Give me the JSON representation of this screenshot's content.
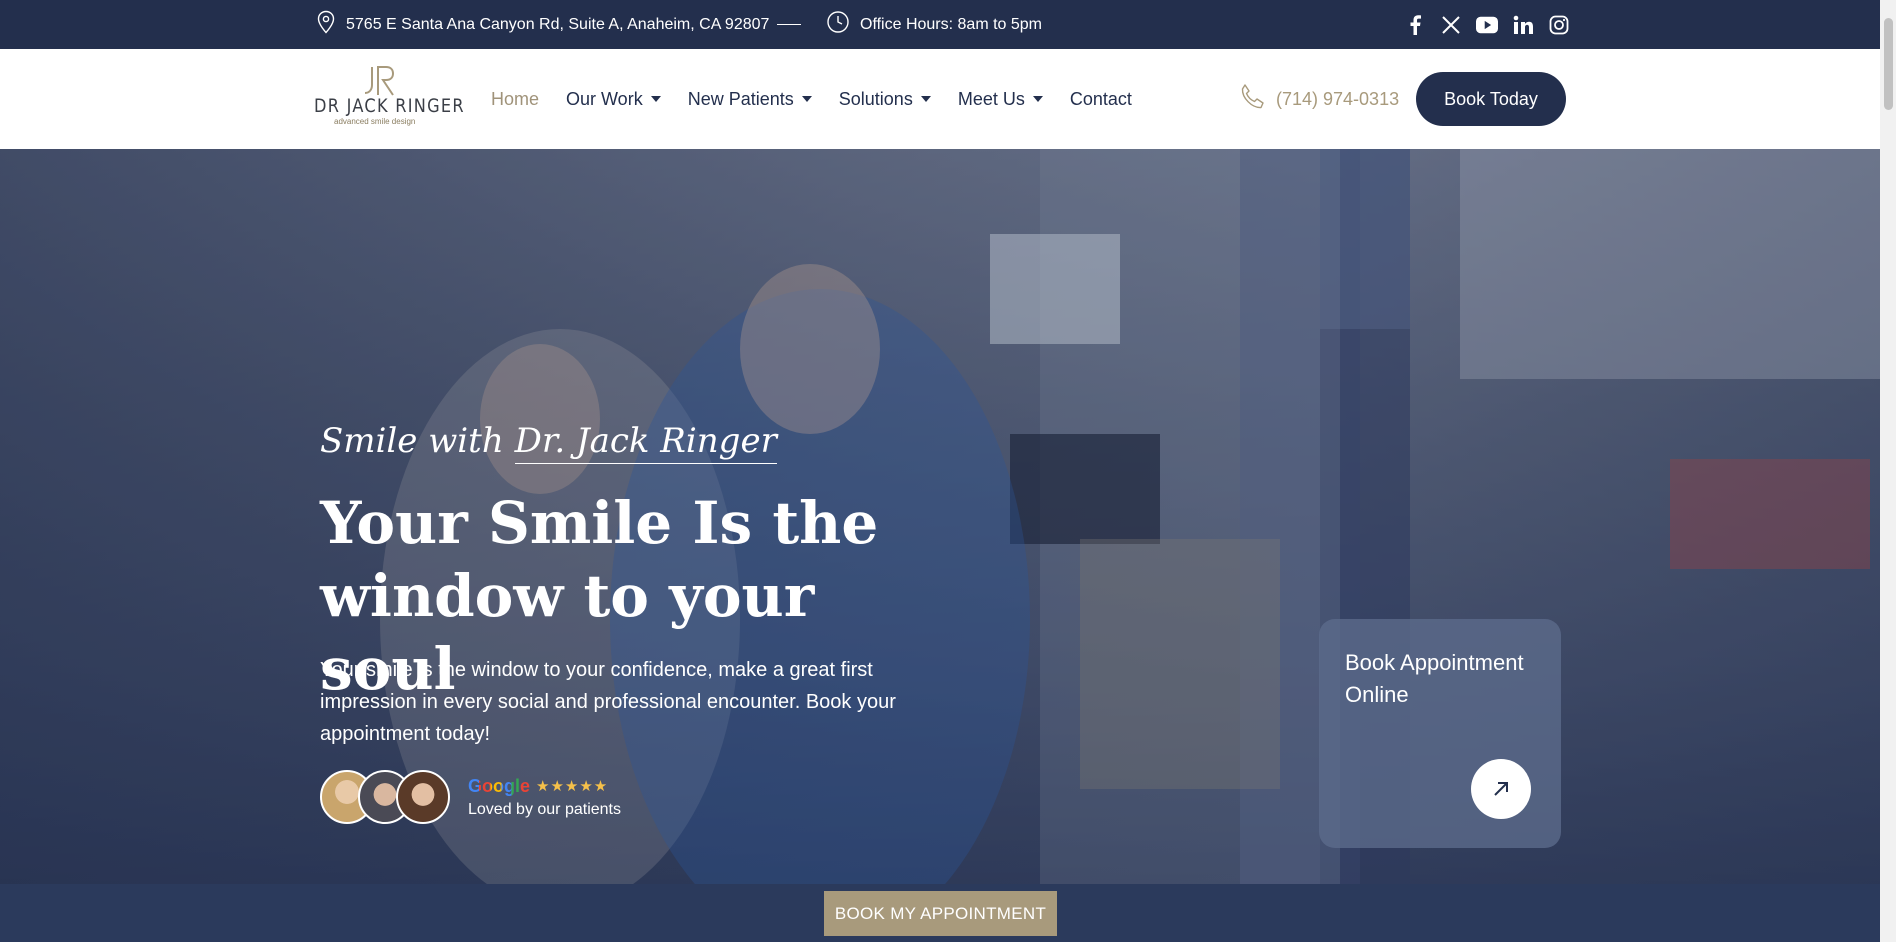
{
  "topbar": {
    "address": "5765 E Santa Ana Canyon Rd, Suite A, Anaheim, CA 92807",
    "hours": "Office Hours: 8am to 5pm",
    "socials": [
      "facebook-icon",
      "x-icon",
      "youtube-icon",
      "linkedin-icon",
      "instagram-icon"
    ]
  },
  "nav": {
    "logo": {
      "name": "DR JACK RINGER",
      "tagline": "advanced smile design",
      "monogram": "JR"
    },
    "items": [
      {
        "label": "Home",
        "dropdown": false,
        "active": true
      },
      {
        "label": "Our Work",
        "dropdown": true
      },
      {
        "label": "New Patients",
        "dropdown": true
      },
      {
        "label": "Solutions",
        "dropdown": true
      },
      {
        "label": "Meet Us",
        "dropdown": true
      },
      {
        "label": "Contact",
        "dropdown": false
      }
    ],
    "phone": "(714) 974-0313",
    "cta": "Book Today"
  },
  "hero": {
    "eyebrow_prefix": "Smile with ",
    "eyebrow_name": "Dr. Jack Ringer",
    "headline": "Your Smile Is the window to your soul",
    "subtext": "Your smile is the window to your confidence, make a great first impression in every social and professional encounter. Book your appointment today!",
    "review_source": "Google",
    "stars": "★★★★★",
    "review_text": "Loved by our patients",
    "book_card": "Book Appointment Online"
  },
  "bottom": {
    "cta": "BOOK MY APPOINTMENT"
  },
  "colors": {
    "navy": "#232f4d",
    "gold": "#a89a7c",
    "white": "#ffffff"
  }
}
